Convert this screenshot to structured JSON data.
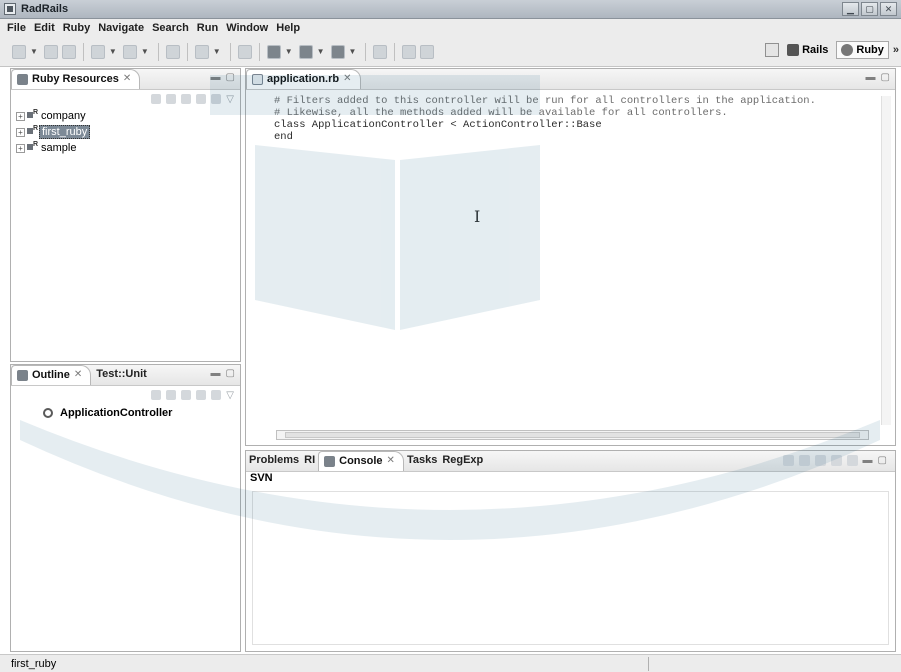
{
  "window": {
    "title": "RadRails"
  },
  "menu": [
    "File",
    "Edit",
    "Ruby",
    "Navigate",
    "Search",
    "Run",
    "Window",
    "Help"
  ],
  "perspectives": {
    "rails_label": "Rails",
    "ruby_label": "Ruby",
    "overflow": "»"
  },
  "resources": {
    "tab_label": "Ruby Resources",
    "items": [
      {
        "label": "company",
        "selected": false
      },
      {
        "label": "first_ruby",
        "selected": true
      },
      {
        "label": "sample",
        "selected": false
      }
    ]
  },
  "outline": {
    "tab_label": "Outline",
    "tab2_label": "Test::Unit",
    "items": [
      {
        "label": "ApplicationController"
      }
    ]
  },
  "editor": {
    "tab_label": "application.rb",
    "lines": [
      "# Filters added to this controller will be run for all controllers in the application.",
      "# Likewise, all the methods added will be available for all controllers.",
      "class ApplicationController < ActionController::Base",
      "end"
    ]
  },
  "bottom": {
    "tabs": [
      "Problems",
      "RI",
      "Console",
      "Tasks",
      "RegExp"
    ],
    "second_row_label": "SVN"
  },
  "status": {
    "text": "first_ruby"
  },
  "watermark": {
    "color": "#c0392b"
  }
}
